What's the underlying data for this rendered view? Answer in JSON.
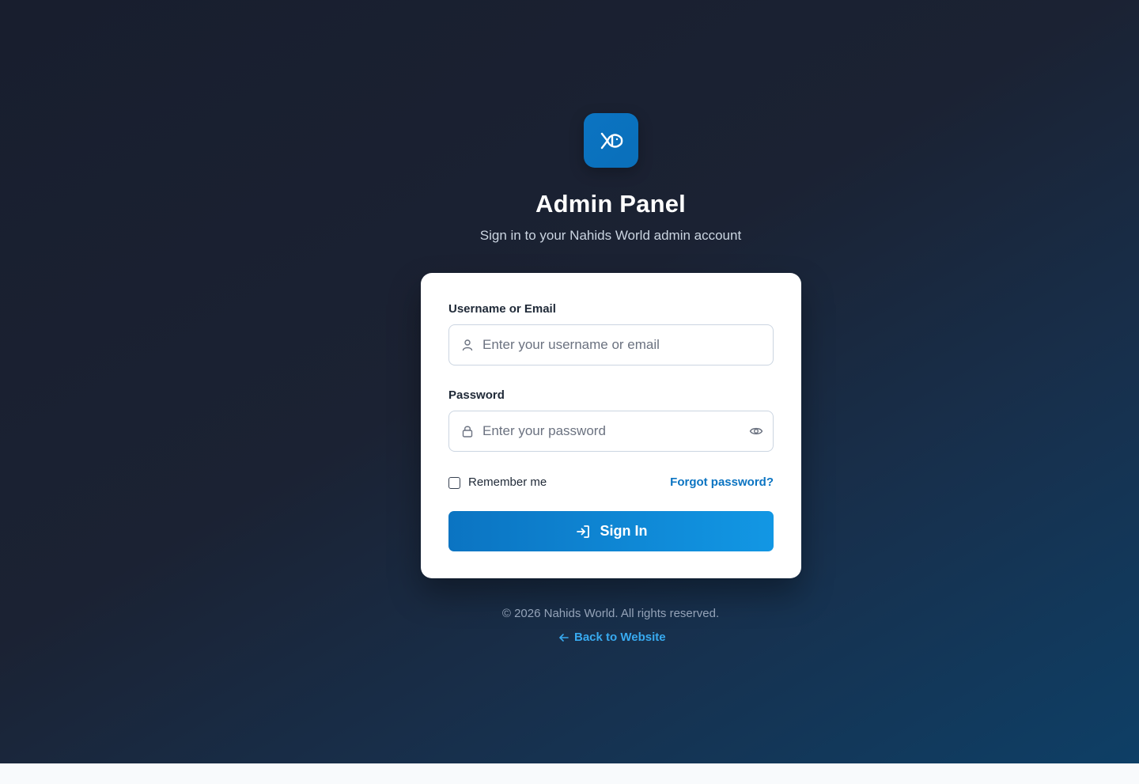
{
  "brand": {
    "logo_icon": "fish-icon",
    "accent_color": "#0b74c2"
  },
  "header": {
    "title": "Admin Panel",
    "subtitle": "Sign in to your Nahids World admin account"
  },
  "form": {
    "username": {
      "label": "Username or Email",
      "placeholder": "Enter your username or email",
      "value": "",
      "icon": "user-icon"
    },
    "password": {
      "label": "Password",
      "placeholder": "Enter your password",
      "value": "",
      "icon": "lock-icon",
      "toggle_icon": "eye-icon"
    },
    "remember_label": "Remember me",
    "remember_checked": false,
    "forgot_label": "Forgot password?",
    "submit_label": "Sign In",
    "submit_icon": "sign-in-icon"
  },
  "footer": {
    "copyright": "© 2026 Nahids World. All rights reserved.",
    "back_label": "Back to Website",
    "back_icon": "arrow-left-icon"
  }
}
